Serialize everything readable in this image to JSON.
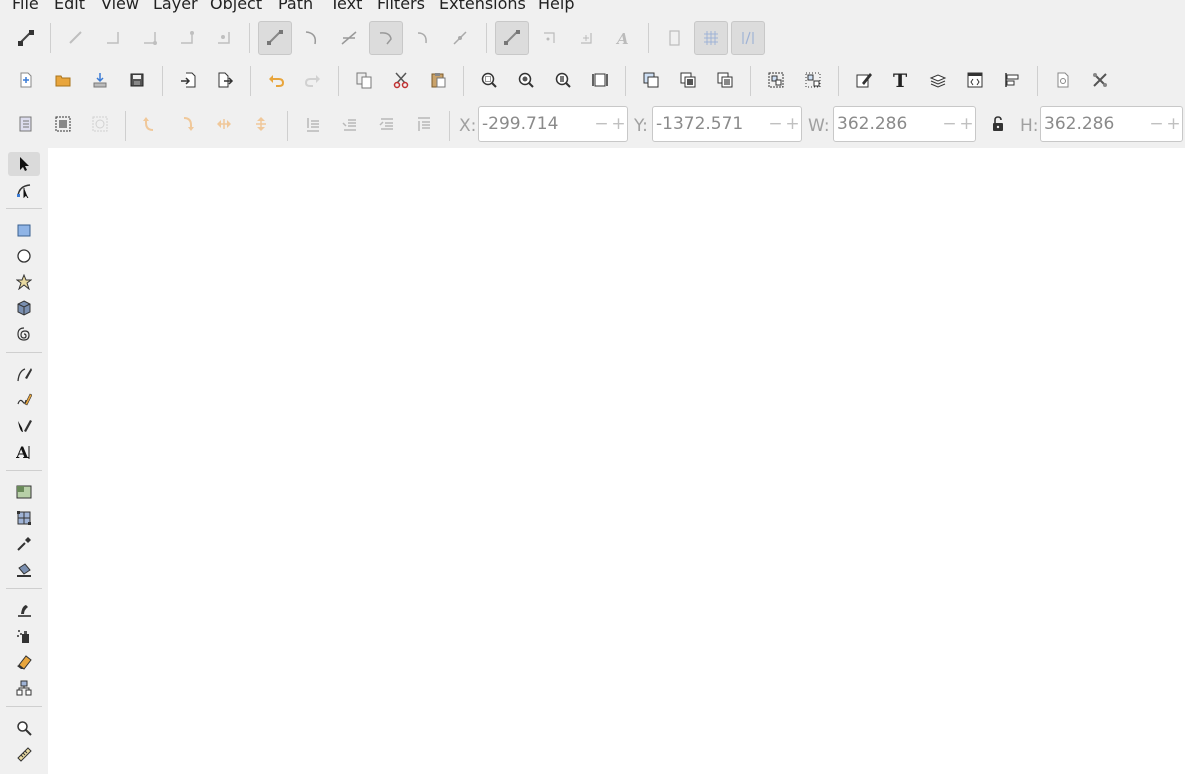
{
  "menu": {
    "items": [
      "File",
      "Edit",
      "View",
      "Layer",
      "Object",
      "Path",
      "Text",
      "Filters",
      "Extensions",
      "Help"
    ]
  },
  "snap_bar": {
    "icons": [
      "snap-toggle-icon",
      "snap-bbox-icon",
      "snap-bbox-edge-icon",
      "snap-bbox-corner-icon",
      "snap-bbox-edge-midpoint-icon",
      "snap-bbox-center-icon",
      "snap-nodes-icon",
      "snap-path-icon",
      "snap-intersection-icon",
      "snap-cusp-icon",
      "snap-smooth-icon",
      "snap-line-midpoint-icon",
      "snap-others-icon",
      "snap-object-center-icon",
      "snap-rotation-center-icon",
      "snap-text-baseline-icon",
      "snap-page-border-icon",
      "snap-grid-icon",
      "snap-guide-icon"
    ]
  },
  "commands_bar": {
    "icons": [
      "new-document-icon",
      "open-icon",
      "print-icon",
      "import-icon",
      "export-icon",
      "import-image-icon",
      "export-png-icon",
      "undo-icon",
      "redo-icon",
      "copy-icon",
      "cut-icon",
      "paste-icon",
      "zoom-selection-icon",
      "zoom-drawing-icon",
      "zoom-page-icon",
      "zoom-page-width-icon",
      "duplicate-icon",
      "clone-icon",
      "unlink-clone-icon",
      "group-icon",
      "ungroup-icon",
      "fill-stroke-icon",
      "text-font-icon",
      "layers-icon",
      "xml-editor-icon",
      "align-distribute-icon",
      "document-properties-icon",
      "preferences-icon"
    ]
  },
  "select_bar": {
    "x_label": "X:",
    "x_value": "-299.714",
    "y_label": "Y:",
    "y_value": "-1372.571",
    "w_label": "W:",
    "w_value": "362.286",
    "h_label": "H:",
    "h_value": "362.286",
    "minus": "−",
    "plus": "+"
  },
  "toolbox": {
    "tools": [
      "selector-tool-icon",
      "node-tool-icon",
      "rectangle-tool-icon",
      "ellipse-tool-icon",
      "star-tool-icon",
      "3d-box-tool-icon",
      "spiral-tool-icon",
      "pen-tool-icon",
      "pencil-tool-icon",
      "calligraphy-tool-icon",
      "text-tool-icon",
      "gradient-tool-icon",
      "mesh-tool-icon",
      "dropper-tool-icon",
      "paint-bucket-tool-icon",
      "tweak-tool-icon",
      "spray-tool-icon",
      "eraser-tool-icon",
      "connector-tool-icon",
      "zoom-tool-icon",
      "measure-tool-icon"
    ]
  },
  "colors": {
    "chrome": "#f0f0f0",
    "canvas": "#ffffff",
    "accent_orange": "#e8a53c",
    "disabled_orange": "#f0c89a",
    "disabled_text": "#8a8a8a"
  }
}
